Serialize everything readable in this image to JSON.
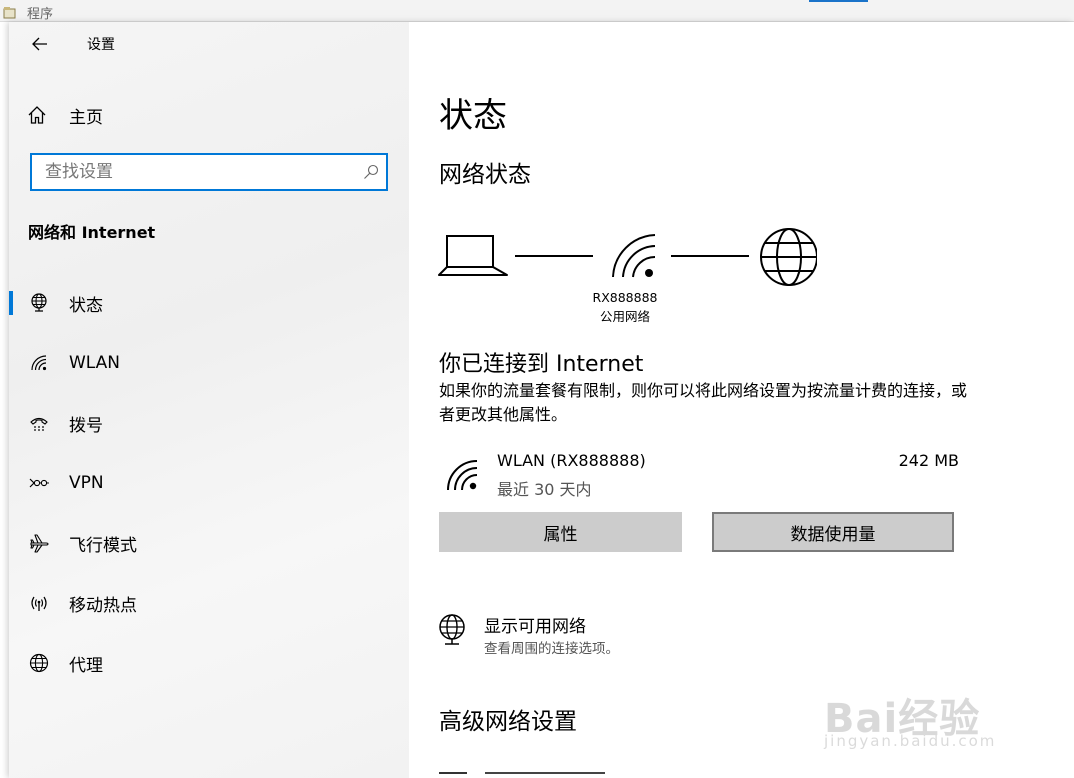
{
  "background_window": {
    "title": "程序"
  },
  "window": {
    "back_icon": "arrow-left-icon",
    "title": "设置"
  },
  "sidebar": {
    "home": {
      "icon": "home-icon",
      "label": "主页"
    },
    "search": {
      "placeholder": "查找设置",
      "icon": "search-icon"
    },
    "section_title": "网络和 Internet",
    "items": [
      {
        "icon": "ethernet-globe-icon",
        "label": "状态",
        "active": true
      },
      {
        "icon": "wifi-icon",
        "label": "WLAN",
        "active": false
      },
      {
        "icon": "dialup-icon",
        "label": "拨号",
        "active": false
      },
      {
        "icon": "vpn-icon",
        "label": "VPN",
        "active": false
      },
      {
        "icon": "airplane-icon",
        "label": "飞行模式",
        "active": false
      },
      {
        "icon": "hotspot-icon",
        "label": "移动热点",
        "active": false
      },
      {
        "icon": "globe-icon",
        "label": "代理",
        "active": false
      }
    ]
  },
  "main": {
    "title": "状态",
    "network_status_heading": "网络状态",
    "diagram": {
      "network_name": "RX888888",
      "network_type": "公用网络"
    },
    "connection": {
      "title": "你已连接到 Internet",
      "description": "如果你的流量套餐有限制，则你可以将此网络设置为按流量计费的连接，或者更改其他属性。"
    },
    "adapter": {
      "icon": "wifi-icon",
      "name": "WLAN (RX888888)",
      "period": "最近 30 天内",
      "usage": "242 MB"
    },
    "buttons": {
      "properties": "属性",
      "data_usage": "数据使用量"
    },
    "available_networks": {
      "icon": "network-globe-icon",
      "title": "显示可用网络",
      "subtitle": "查看周围的连接选项。"
    },
    "advanced_heading": "高级网络设置"
  },
  "watermark": {
    "text": "Bai经验",
    "url": "jingyan.baidu.com"
  },
  "colors": {
    "accent": "#0078d7",
    "button_bg": "#cccccc",
    "sidebar_bg": "#f2f2f2"
  }
}
